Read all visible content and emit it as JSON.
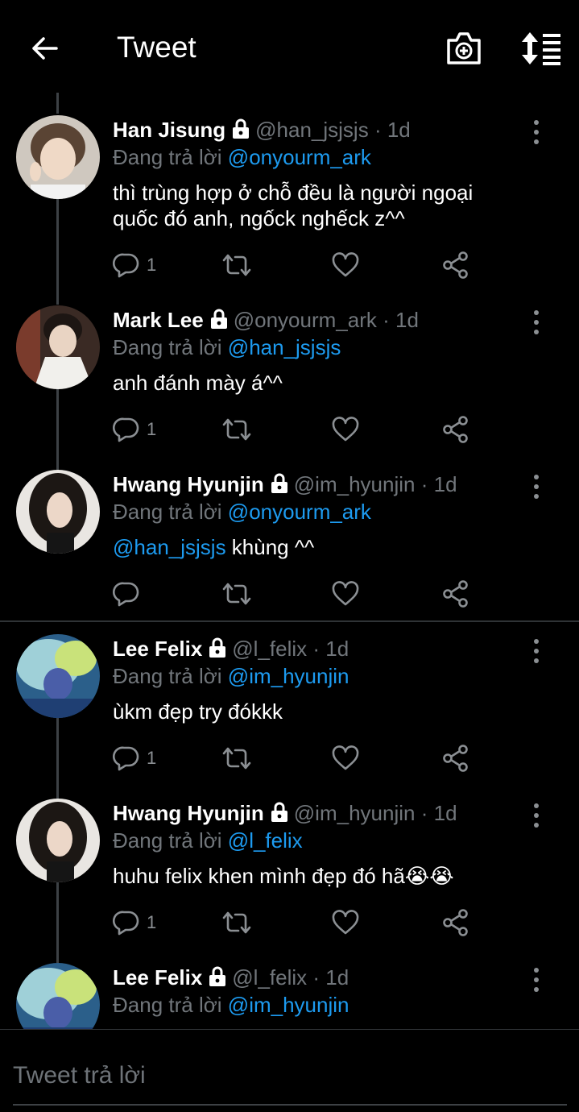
{
  "header": {
    "title": "Tweet"
  },
  "colors": {
    "background": "#000000",
    "mention": "#1d9bf0",
    "muted": "#71767b",
    "text": "#ffffff"
  },
  "reply_label": "Đang trả lời",
  "tweets": [
    {
      "name": "Han Jisung",
      "handle": "@han_jsjsjs",
      "dot": "·",
      "time": "1d",
      "reply_to": "@onyourm_ark",
      "body_lines": [
        "thì trùng hợp ở chỗ đều là người ngoại",
        "quốc đó anh, ngốck nghếck z^^"
      ],
      "reply_count": "1"
    },
    {
      "name": "Mark Lee",
      "handle": "@onyourm_ark",
      "dot": "·",
      "time": "1d",
      "reply_to": "@han_jsjsjs",
      "body_lines": [
        "anh đánh mày á^^"
      ],
      "reply_count": "1"
    },
    {
      "name": "Hwang Hyunjin",
      "handle": "@im_hyunjin",
      "dot": "·",
      "time": "1d",
      "reply_to": "@onyourm_ark",
      "body_mention": "@han_jsjsjs",
      "body_text": " khùng ^^",
      "reply_count": ""
    },
    {
      "name": "Lee Felix",
      "handle": "@l_felix",
      "dot": "·",
      "time": "1d",
      "reply_to": "@im_hyunjin",
      "body_lines": [
        "ùkm đẹp try đókkk"
      ],
      "reply_count": "1"
    },
    {
      "name": "Hwang Hyunjin",
      "handle": "@im_hyunjin",
      "dot": "·",
      "time": "1d",
      "reply_to": "@l_felix",
      "body_lines": [
        "huhu felix khen mình đẹp đó hã😭😭"
      ],
      "reply_count": "1"
    },
    {
      "name": "Lee Felix",
      "handle": "@l_felix",
      "dot": "·",
      "time": "1d",
      "reply_to": "@im_hyunjin"
    }
  ],
  "reply_box": {
    "placeholder": "Tweet trả lời"
  },
  "icons": {
    "back": "arrow-left-icon",
    "camera": "camera-plus-icon",
    "sort": "sort-icon",
    "lock": "lock-icon",
    "more": "more-vertical-icon",
    "reply": "reply-icon",
    "retweet": "retweet-icon",
    "like": "heart-icon",
    "share": "share-icon"
  }
}
